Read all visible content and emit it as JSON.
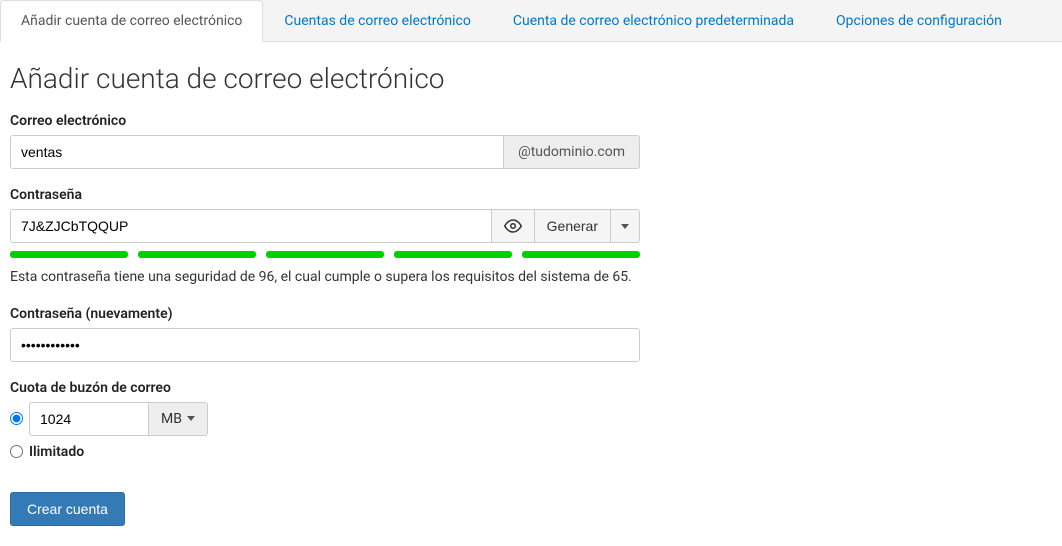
{
  "tabs": {
    "add_account": "Añadir cuenta de correo electrónico",
    "accounts": "Cuentas de correo electrónico",
    "default_account": "Cuenta de correo electrónico predeterminada",
    "config_options": "Opciones de configuración"
  },
  "page_title": "Añadir cuenta de correo electrónico",
  "fields": {
    "email_label": "Correo electrónico",
    "email_value": "ventas",
    "email_domain": "@tudominio.com",
    "password_label": "Contraseña",
    "password_value": "7J&ZJCbTQQUP",
    "generate_label": "Generar",
    "strength_text": "Esta contraseña tiene una seguridad de 96, el cual cumple o supera los requisitos del sistema de 65.",
    "password_confirm_label": "Contraseña (nuevamente)",
    "password_confirm_value": "••••••••••••",
    "quota_label": "Cuota de buzón de correo",
    "quota_value": "1024",
    "quota_unit": "MB",
    "unlimited_label": "Ilimitado"
  },
  "buttons": {
    "create": "Crear cuenta"
  }
}
